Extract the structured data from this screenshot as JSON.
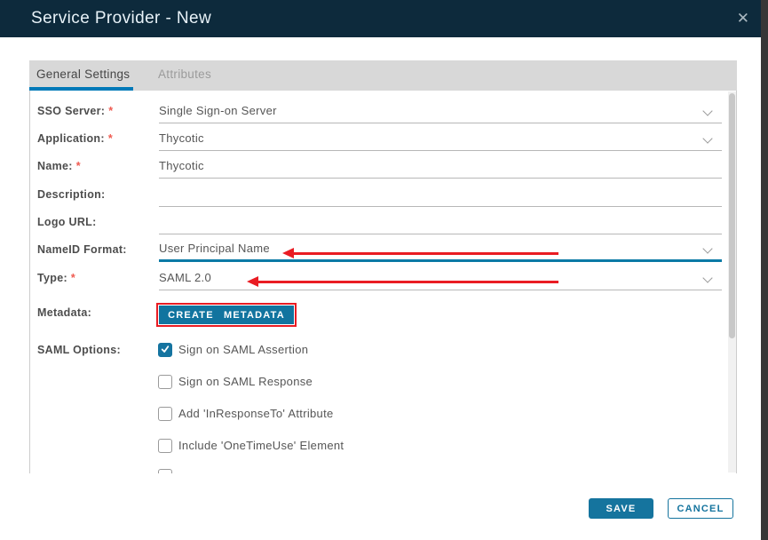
{
  "dialog": {
    "title": "Service Provider - New",
    "close_glyph": "✕"
  },
  "tabs": {
    "general": "General Settings",
    "attributes": "Attributes"
  },
  "required_marker": "*",
  "form": {
    "sso_server": {
      "label": "SSO Server:",
      "required": true,
      "value": "Single Sign-on Server"
    },
    "application": {
      "label": "Application:",
      "required": true,
      "value": "Thycotic"
    },
    "name": {
      "label": "Name:",
      "required": true,
      "value": "Thycotic"
    },
    "description": {
      "label": "Description:",
      "required": false,
      "value": ""
    },
    "logo_url": {
      "label": "Logo URL:",
      "required": false,
      "value": ""
    },
    "nameid_format": {
      "label": "NameID Format:",
      "required": false,
      "value": "User Principal Name",
      "focused": true,
      "annotated": true
    },
    "type": {
      "label": "Type:",
      "required": true,
      "value": "SAML 2.0",
      "annotated": true
    },
    "metadata": {
      "label": "Metadata:",
      "button_label": "CREATE METADATA",
      "highlighted": true
    },
    "saml_options": {
      "label": "SAML Options:",
      "items": [
        {
          "label": "Sign on SAML Assertion",
          "checked": true
        },
        {
          "label": "Sign on SAML Response",
          "checked": false
        },
        {
          "label": "Add 'InResponseTo' Attribute",
          "checked": false
        },
        {
          "label": "Include 'OneTimeUse' Element",
          "checked": false
        }
      ]
    }
  },
  "footer": {
    "save_label": "SAVE",
    "cancel_label": "CANCEL"
  },
  "colors": {
    "header_navy": "#0d2a3c",
    "accent_blue": "#0079b8",
    "button_teal": "#15749e",
    "annotation_red": "#e91c23",
    "required_red": "#ef5a50",
    "tab_bar_gray": "#d8d8d8"
  }
}
